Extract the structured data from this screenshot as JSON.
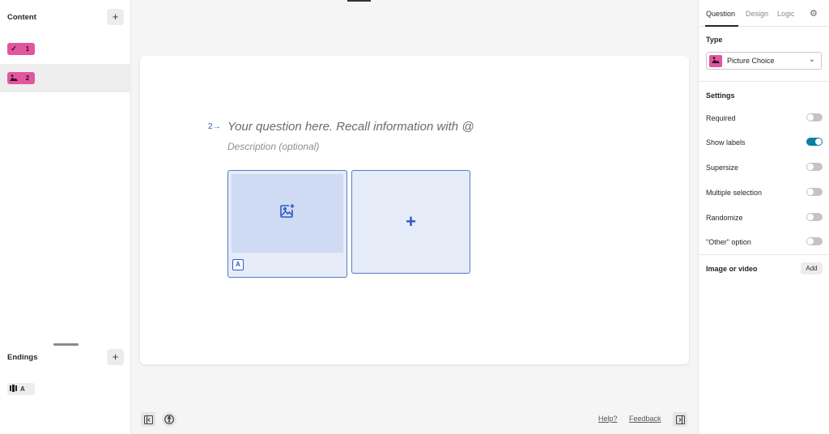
{
  "sidebar": {
    "content_title": "Content",
    "add_content_label": "+",
    "questions": [
      {
        "icon": "checkmark-icon",
        "number": "1"
      },
      {
        "icon": "picture-icon",
        "number": "2"
      }
    ],
    "endings_title": "Endings",
    "add_ending_label": "+",
    "ending": {
      "icon": "ending-icon",
      "label": "A"
    }
  },
  "editor": {
    "question_number": "2",
    "question_arrow": "→",
    "title_placeholder": "Your question here. Recall information with @",
    "description_placeholder": "Description (optional)",
    "choices": [
      {
        "key": "A"
      }
    ],
    "add_choice_label": "+"
  },
  "footer": {
    "help_label": "Help?",
    "feedback_label": "Feedback"
  },
  "panel": {
    "tabs": [
      "Question",
      "Design",
      "Logic"
    ],
    "active_tab": "Question",
    "type_label": "Type",
    "type_value": "Picture Choice",
    "settings_label": "Settings",
    "settings": [
      {
        "label": "Required",
        "on": false
      },
      {
        "label": "Show labels",
        "on": true
      },
      {
        "label": "Supersize",
        "on": false
      },
      {
        "label": "Multiple selection",
        "on": false
      },
      {
        "label": "Randomize",
        "on": false
      },
      {
        "label": "\"Other\" option",
        "on": false
      }
    ],
    "media_label": "Image or video",
    "media_add_label": "Add"
  },
  "colors": {
    "question_badge": "#e2569f",
    "accent_blue": "#2f58c7",
    "toggle_on": "#0c7ea3"
  }
}
